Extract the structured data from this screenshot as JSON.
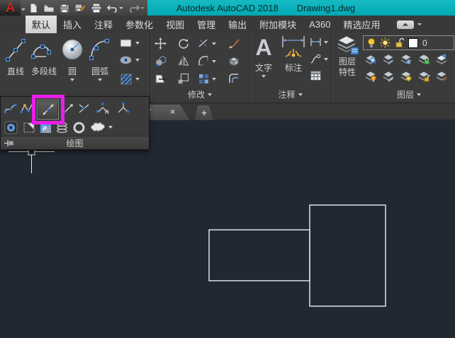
{
  "titlebar": {
    "logo_glyph": "A",
    "app_title": "Autodesk AutoCAD 2018",
    "doc_title": "Drawing1.dwg",
    "qat_icons": [
      "new-file",
      "open-file",
      "save",
      "save-as",
      "plot",
      "undo",
      "redo",
      "customize-toolbar"
    ]
  },
  "ribbon": {
    "tabs": [
      "默认",
      "插入",
      "注释",
      "参数化",
      "视图",
      "管理",
      "输出",
      "附加模块",
      "A360",
      "精选应用"
    ],
    "active_tab": "默认"
  },
  "draw_panel": {
    "label": "绘图",
    "line": "直线",
    "polyline": "多段线",
    "circle": "圆",
    "arc": "圆弧",
    "small_tools": [
      "rectangle",
      "ellipse",
      "hatch"
    ]
  },
  "modify_panel": {
    "label": "修改",
    "tools": [
      "move",
      "rotate",
      "trim",
      "erase",
      "copy",
      "mirror",
      "fillet",
      "explode",
      "stretch",
      "scale",
      "array",
      "offset"
    ]
  },
  "annotate_panel": {
    "label": "注释",
    "text": "文字",
    "text_icon_glyph": "A",
    "dimension": "标注",
    "small_tools": [
      "linear-dimension",
      "leader",
      "table"
    ]
  },
  "layers_panel": {
    "label": "图层",
    "properties_line1": "图层",
    "properties_line2": "特性",
    "current_layer": "0",
    "combo_icons": [
      "bulb-on",
      "sun",
      "unlock",
      "color-swatch"
    ],
    "tool_icons_row1": [
      "layer-isolate",
      "layer-restore",
      "layer-freeze",
      "layer-lock",
      "layer-make-current"
    ],
    "tool_icons_row2": [
      "layer-off",
      "layer-match",
      "layer-thaw",
      "layer-unlock",
      "layer-previous"
    ]
  },
  "flyout": {
    "label": "绘图",
    "divide_glyph": "n",
    "wipeout_glyph": "a",
    "row1_tools": [
      "spline-fit",
      "spline-cv",
      "construction-line",
      "ray",
      "multiple-points",
      "divide",
      "measure"
    ],
    "row2_tools": [
      "boundary",
      "region",
      "wipeout",
      "helix",
      "donut",
      "revision-cloud"
    ],
    "highlighted_tool": "construction-line"
  },
  "file_tabs": {
    "modified_glyph": "*",
    "close_glyph": "×",
    "new_tab_glyph": "+"
  },
  "colors": {
    "teal": "#0bb4be",
    "highlight_box": "#e81ee8",
    "canvas_bg": "#222831",
    "geometry_line": "#dde1e5"
  }
}
